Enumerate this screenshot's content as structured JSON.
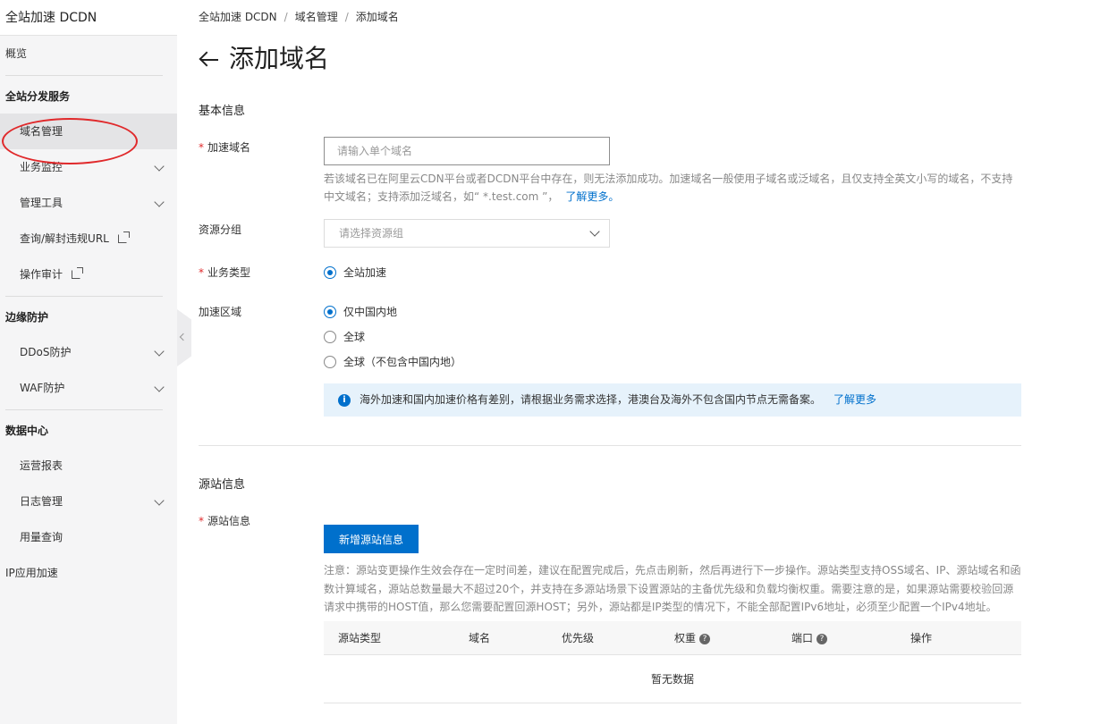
{
  "sidebar": {
    "title": "全站加速 DCDN",
    "overview": "概览",
    "groups": [
      {
        "label": "全站分发服务"
      },
      {
        "label": "边缘防护"
      },
      {
        "label": "数据中心"
      }
    ],
    "items": {
      "domain_mgmt": "域名管理",
      "biz_monitor": "业务监控",
      "mgmt_tools": "管理工具",
      "query_unblock": "查询/解封违规URL",
      "op_audit": "操作审计",
      "ddos": "DDoS防护",
      "waf": "WAF防护",
      "ops_report": "运营报表",
      "log_mgmt": "日志管理",
      "usage_query": "用量查询",
      "ip_accel": "IP应用加速"
    }
  },
  "breadcrumb": [
    "全站加速 DCDN",
    "域名管理",
    "添加域名"
  ],
  "page": {
    "title": "添加域名"
  },
  "basic": {
    "section_title": "基本信息",
    "domain_label": "加速域名",
    "domain_placeholder": "请输入单个域名",
    "domain_help": "若该域名已在阿里云CDN平台或者DCDN平台中存在，则无法添加成功。加速域名一般使用子域名或泛域名，且仅支持全英文小写的域名，不支持中文域名；支持添加泛域名，如“ *.test.com ”，",
    "learn_more": "了解更多。",
    "resource_group_label": "资源分组",
    "resource_group_placeholder": "请选择资源组",
    "biz_type_label": "业务类型",
    "biz_type_option": "全站加速",
    "region_label": "加速区域",
    "region_options": [
      "仅中国内地",
      "全球",
      "全球（不包含中国内地）"
    ],
    "info_text": "海外加速和国内加速价格有差别，请根据业务需求选择，港澳台及海外不包含国内节点无需备案。",
    "info_link": "了解更多"
  },
  "origin": {
    "section_title": "源站信息",
    "label": "源站信息",
    "add_button": "新增源站信息",
    "note": "注意：源站变更操作生效会存在一定时间差，建议在配置完成后，先点击刷新，然后再进行下一步操作。源站类型支持OSS域名、IP、源站域名和函数计算域名，源站总数量最大不超过20个，并支持在多源站场景下设置源站的主备优先级和负载均衡权重。需要注意的是，如果源站需要校验回源请求中携带的HOST值，那么您需要配置回源HOST；另外，源站都是IP类型的情况下，不能全部配置IPv6地址，必须至少配置一个IPv4地址。",
    "columns": [
      "源站类型",
      "域名",
      "优先级",
      "权重",
      "端口",
      "操作"
    ],
    "empty_text": "暂无数据"
  },
  "icons": {
    "back": "back-arrow-icon",
    "info": "info-icon",
    "help": "question-icon",
    "external": "external-link-icon",
    "chevron": "chevron-down-icon"
  },
  "colors": {
    "primary": "#0070cc",
    "required": "#e0292b",
    "info_bg": "#e6f2fb"
  }
}
